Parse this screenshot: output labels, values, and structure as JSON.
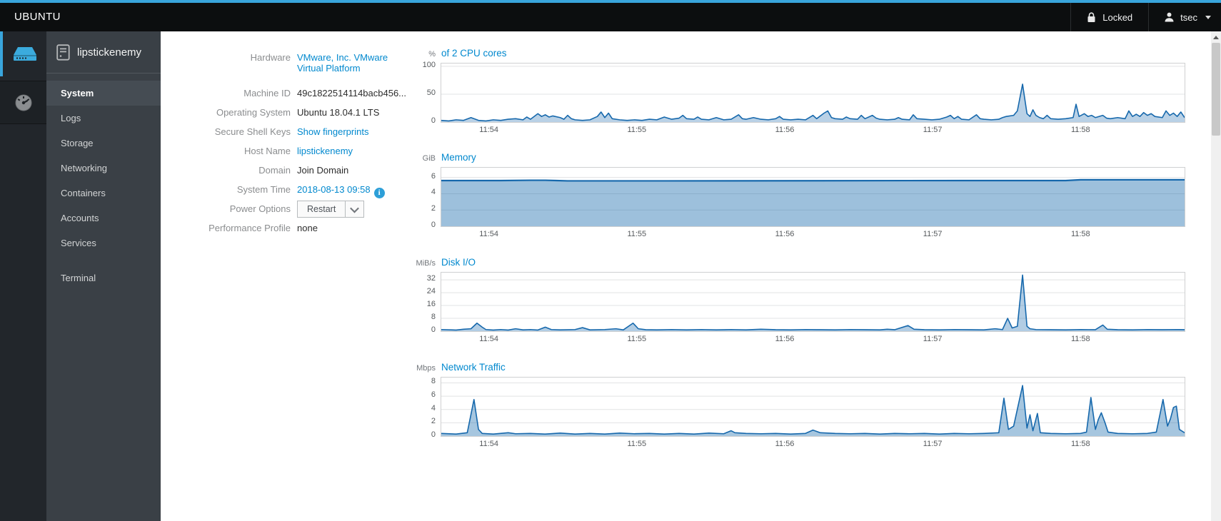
{
  "navbar": {
    "brand": "UBUNTU",
    "locked_label": "Locked",
    "user": "tsec"
  },
  "sidebar": {
    "host": "lipstickenemy",
    "items": [
      {
        "label": "System",
        "active": true
      },
      {
        "label": "Logs"
      },
      {
        "label": "Storage"
      },
      {
        "label": "Networking"
      },
      {
        "label": "Containers"
      },
      {
        "label": "Accounts"
      },
      {
        "label": "Services"
      }
    ],
    "terminal": {
      "label": "Terminal"
    }
  },
  "system": {
    "rows": [
      {
        "label": "Hardware",
        "value": "VMware, Inc. VMware Virtual Platform",
        "value_line1": "VMware, Inc. VMware",
        "value_line2": "Virtual Platform",
        "type": "link"
      },
      {
        "label": "Machine ID",
        "value": "49c1822514114bacb456...",
        "type": "text"
      },
      {
        "label": "Operating System",
        "value": "Ubuntu 18.04.1 LTS",
        "type": "text"
      },
      {
        "label": "Secure Shell Keys",
        "value": "Show fingerprints",
        "type": "link"
      },
      {
        "label": "Host Name",
        "value": "lipstickenemy",
        "type": "link"
      },
      {
        "label": "Domain",
        "value": "Join Domain",
        "type": "text"
      },
      {
        "label": "System Time",
        "value": "2018-08-13 09:58",
        "type": "link",
        "icon": "info-icon"
      },
      {
        "label": "Power Options",
        "value": "Restart",
        "type": "split-button"
      },
      {
        "label": "Performance Profile",
        "value": "none",
        "type": "text"
      }
    ]
  },
  "colors": {
    "accent": "#39a5dc",
    "link": "#0088ce",
    "chart_line": "#1668ac",
    "grid": "#e2e3e4"
  },
  "chart_data": [
    {
      "id": "cpu",
      "type": "area",
      "unit": "%",
      "title": "of 2 CPU cores",
      "ylabel": "percent",
      "ylim": [
        0,
        105
      ],
      "yticks": [
        100,
        50,
        0
      ],
      "grid": true,
      "xticks": [
        {
          "f": 0.065,
          "label": "11:54"
        },
        {
          "f": 0.264,
          "label": "11:55"
        },
        {
          "f": 0.463,
          "label": "11:56"
        },
        {
          "f": 0.662,
          "label": "11:57"
        },
        {
          "f": 0.861,
          "label": "11:58"
        }
      ],
      "line": "#1668ac",
      "fill": "rgba(22,104,172,0.30)",
      "line_width": 1.6,
      "points": [
        [
          0,
          3
        ],
        [
          0.01,
          2
        ],
        [
          0.02,
          4
        ],
        [
          0.03,
          3
        ],
        [
          0.04,
          8
        ],
        [
          0.05,
          3
        ],
        [
          0.06,
          2
        ],
        [
          0.07,
          4
        ],
        [
          0.08,
          3
        ],
        [
          0.09,
          5
        ],
        [
          0.1,
          6
        ],
        [
          0.11,
          4
        ],
        [
          0.115,
          9
        ],
        [
          0.12,
          5
        ],
        [
          0.13,
          15
        ],
        [
          0.135,
          10
        ],
        [
          0.14,
          13
        ],
        [
          0.145,
          9
        ],
        [
          0.15,
          11
        ],
        [
          0.16,
          8
        ],
        [
          0.165,
          5
        ],
        [
          0.17,
          12
        ],
        [
          0.175,
          6
        ],
        [
          0.18,
          4
        ],
        [
          0.19,
          3
        ],
        [
          0.2,
          4
        ],
        [
          0.21,
          10
        ],
        [
          0.215,
          18
        ],
        [
          0.22,
          8
        ],
        [
          0.225,
          16
        ],
        [
          0.23,
          6
        ],
        [
          0.24,
          4
        ],
        [
          0.25,
          3
        ],
        [
          0.26,
          4
        ],
        [
          0.27,
          3
        ],
        [
          0.28,
          5
        ],
        [
          0.29,
          4
        ],
        [
          0.3,
          9
        ],
        [
          0.31,
          5
        ],
        [
          0.32,
          7
        ],
        [
          0.325,
          12
        ],
        [
          0.33,
          6
        ],
        [
          0.34,
          5
        ],
        [
          0.345,
          9
        ],
        [
          0.35,
          5
        ],
        [
          0.36,
          4
        ],
        [
          0.37,
          8
        ],
        [
          0.38,
          4
        ],
        [
          0.39,
          5
        ],
        [
          0.4,
          13
        ],
        [
          0.405,
          6
        ],
        [
          0.41,
          5
        ],
        [
          0.42,
          8
        ],
        [
          0.43,
          5
        ],
        [
          0.44,
          4
        ],
        [
          0.45,
          6
        ],
        [
          0.455,
          10
        ],
        [
          0.46,
          5
        ],
        [
          0.47,
          4
        ],
        [
          0.48,
          5
        ],
        [
          0.49,
          4
        ],
        [
          0.5,
          12
        ],
        [
          0.505,
          6
        ],
        [
          0.515,
          16
        ],
        [
          0.52,
          20
        ],
        [
          0.525,
          8
        ],
        [
          0.53,
          6
        ],
        [
          0.54,
          5
        ],
        [
          0.545,
          9
        ],
        [
          0.55,
          6
        ],
        [
          0.56,
          5
        ],
        [
          0.565,
          12
        ],
        [
          0.57,
          6
        ],
        [
          0.58,
          12
        ],
        [
          0.585,
          7
        ],
        [
          0.59,
          5
        ],
        [
          0.6,
          4
        ],
        [
          0.61,
          5
        ],
        [
          0.615,
          8
        ],
        [
          0.62,
          5
        ],
        [
          0.63,
          4
        ],
        [
          0.635,
          13
        ],
        [
          0.64,
          6
        ],
        [
          0.65,
          5
        ],
        [
          0.66,
          4
        ],
        [
          0.67,
          5
        ],
        [
          0.68,
          9
        ],
        [
          0.685,
          12
        ],
        [
          0.69,
          6
        ],
        [
          0.695,
          10
        ],
        [
          0.7,
          5
        ],
        [
          0.71,
          4
        ],
        [
          0.72,
          13
        ],
        [
          0.725,
          6
        ],
        [
          0.73,
          5
        ],
        [
          0.74,
          4
        ],
        [
          0.75,
          5
        ],
        [
          0.755,
          8
        ],
        [
          0.76,
          10
        ],
        [
          0.77,
          12
        ],
        [
          0.775,
          20
        ],
        [
          0.782,
          68
        ],
        [
          0.788,
          15
        ],
        [
          0.792,
          10
        ],
        [
          0.796,
          22
        ],
        [
          0.8,
          12
        ],
        [
          0.805,
          8
        ],
        [
          0.81,
          6
        ],
        [
          0.815,
          12
        ],
        [
          0.82,
          6
        ],
        [
          0.83,
          5
        ],
        [
          0.84,
          6
        ],
        [
          0.85,
          8
        ],
        [
          0.854,
          32
        ],
        [
          0.858,
          10
        ],
        [
          0.865,
          15
        ],
        [
          0.87,
          10
        ],
        [
          0.875,
          12
        ],
        [
          0.88,
          8
        ],
        [
          0.89,
          12
        ],
        [
          0.895,
          7
        ],
        [
          0.9,
          6
        ],
        [
          0.91,
          8
        ],
        [
          0.92,
          6
        ],
        [
          0.925,
          20
        ],
        [
          0.93,
          10
        ],
        [
          0.935,
          14
        ],
        [
          0.94,
          10
        ],
        [
          0.945,
          17
        ],
        [
          0.95,
          12
        ],
        [
          0.955,
          15
        ],
        [
          0.96,
          10
        ],
        [
          0.97,
          8
        ],
        [
          0.975,
          20
        ],
        [
          0.98,
          12
        ],
        [
          0.985,
          16
        ],
        [
          0.99,
          10
        ],
        [
          0.995,
          18
        ],
        [
          1,
          8
        ]
      ]
    },
    {
      "id": "memory",
      "type": "area",
      "unit": "GiB",
      "title": "Memory",
      "ylabel": "GiB",
      "ylim": [
        0,
        7.2
      ],
      "yticks": [
        6,
        4,
        2,
        0
      ],
      "grid": true,
      "xticks": [
        {
          "f": 0.065,
          "label": "11:54"
        },
        {
          "f": 0.264,
          "label": "11:55"
        },
        {
          "f": 0.463,
          "label": "11:56"
        },
        {
          "f": 0.662,
          "label": "11:57"
        },
        {
          "f": 0.861,
          "label": "11:58"
        }
      ],
      "line": "#1668ac",
      "fill": "rgba(22,104,172,0.42)",
      "line_width": 2.2,
      "points": [
        [
          0,
          5.62
        ],
        [
          0.08,
          5.62
        ],
        [
          0.12,
          5.66
        ],
        [
          0.14,
          5.66
        ],
        [
          0.155,
          5.62
        ],
        [
          0.17,
          5.58
        ],
        [
          0.3,
          5.58
        ],
        [
          0.5,
          5.6
        ],
        [
          0.7,
          5.62
        ],
        [
          0.84,
          5.62
        ],
        [
          0.86,
          5.72
        ],
        [
          1,
          5.72
        ]
      ]
    },
    {
      "id": "disk-io",
      "type": "area",
      "unit": "MiB/s",
      "title": "Disk I/O",
      "ylabel": "MiB/s",
      "ylim": [
        0,
        36.5
      ],
      "yticks": [
        32,
        24,
        16,
        8,
        0
      ],
      "grid": true,
      "xticks": [
        {
          "f": 0.065,
          "label": "11:54"
        },
        {
          "f": 0.264,
          "label": "11:55"
        },
        {
          "f": 0.463,
          "label": "11:56"
        },
        {
          "f": 0.662,
          "label": "11:57"
        },
        {
          "f": 0.861,
          "label": "11:58"
        }
      ],
      "line": "#1668ac",
      "fill": "rgba(22,104,172,0.33)",
      "line_width": 1.6,
      "points": [
        [
          0,
          1
        ],
        [
          0.02,
          0.7
        ],
        [
          0.03,
          1.2
        ],
        [
          0.04,
          1.5
        ],
        [
          0.048,
          5
        ],
        [
          0.055,
          2.5
        ],
        [
          0.06,
          1
        ],
        [
          0.07,
          0.7
        ],
        [
          0.08,
          1
        ],
        [
          0.09,
          0.7
        ],
        [
          0.1,
          1.5
        ],
        [
          0.11,
          0.8
        ],
        [
          0.12,
          1
        ],
        [
          0.13,
          0.7
        ],
        [
          0.14,
          2.5
        ],
        [
          0.148,
          1
        ],
        [
          0.16,
          0.8
        ],
        [
          0.18,
          1
        ],
        [
          0.19,
          2.2
        ],
        [
          0.2,
          0.8
        ],
        [
          0.22,
          1
        ],
        [
          0.235,
          1.5
        ],
        [
          0.245,
          0.8
        ],
        [
          0.258,
          5
        ],
        [
          0.265,
          1.5
        ],
        [
          0.275,
          0.9
        ],
        [
          0.29,
          0.8
        ],
        [
          0.31,
          1
        ],
        [
          0.33,
          0.8
        ],
        [
          0.35,
          1
        ],
        [
          0.37,
          0.8
        ],
        [
          0.39,
          1
        ],
        [
          0.41,
          0.8
        ],
        [
          0.43,
          1.2
        ],
        [
          0.45,
          0.9
        ],
        [
          0.47,
          0.8
        ],
        [
          0.49,
          1
        ],
        [
          0.51,
          0.9
        ],
        [
          0.53,
          0.8
        ],
        [
          0.55,
          1
        ],
        [
          0.57,
          0.9
        ],
        [
          0.59,
          0.8
        ],
        [
          0.6,
          1.2
        ],
        [
          0.61,
          0.9
        ],
        [
          0.628,
          3.5
        ],
        [
          0.636,
          1.2
        ],
        [
          0.65,
          0.9
        ],
        [
          0.67,
          0.8
        ],
        [
          0.69,
          1
        ],
        [
          0.71,
          0.9
        ],
        [
          0.73,
          0.8
        ],
        [
          0.745,
          1.5
        ],
        [
          0.755,
          1
        ],
        [
          0.762,
          8
        ],
        [
          0.768,
          2
        ],
        [
          0.775,
          3
        ],
        [
          0.782,
          35
        ],
        [
          0.788,
          3
        ],
        [
          0.792,
          1.5
        ],
        [
          0.8,
          1
        ],
        [
          0.82,
          0.9
        ],
        [
          0.84,
          0.8
        ],
        [
          0.86,
          1
        ],
        [
          0.88,
          0.9
        ],
        [
          0.89,
          3.8
        ],
        [
          0.896,
          1.2
        ],
        [
          0.91,
          0.9
        ],
        [
          0.93,
          0.8
        ],
        [
          0.95,
          1
        ],
        [
          0.97,
          0.9
        ],
        [
          0.99,
          1
        ],
        [
          1,
          0.9
        ]
      ]
    },
    {
      "id": "network",
      "type": "area",
      "unit": "Mbps",
      "title": "Network Traffic",
      "ylabel": "Mbps",
      "ylim": [
        0,
        8.8
      ],
      "yticks": [
        8,
        6,
        4,
        2,
        0
      ],
      "grid": true,
      "xticks": [
        {
          "f": 0.065,
          "label": "11:54"
        },
        {
          "f": 0.264,
          "label": "11:55"
        },
        {
          "f": 0.463,
          "label": "11:56"
        },
        {
          "f": 0.662,
          "label": "11:57"
        },
        {
          "f": 0.861,
          "label": "11:58"
        }
      ],
      "line": "#1668ac",
      "fill": "rgba(22,104,172,0.38)",
      "line_width": 1.6,
      "points": [
        [
          0,
          0.4
        ],
        [
          0.02,
          0.3
        ],
        [
          0.035,
          0.5
        ],
        [
          0.044,
          5.5
        ],
        [
          0.05,
          1
        ],
        [
          0.055,
          0.4
        ],
        [
          0.07,
          0.3
        ],
        [
          0.09,
          0.5
        ],
        [
          0.1,
          0.35
        ],
        [
          0.12,
          0.4
        ],
        [
          0.14,
          0.3
        ],
        [
          0.16,
          0.45
        ],
        [
          0.18,
          0.3
        ],
        [
          0.2,
          0.4
        ],
        [
          0.22,
          0.3
        ],
        [
          0.24,
          0.45
        ],
        [
          0.26,
          0.35
        ],
        [
          0.28,
          0.4
        ],
        [
          0.3,
          0.3
        ],
        [
          0.32,
          0.4
        ],
        [
          0.34,
          0.3
        ],
        [
          0.36,
          0.45
        ],
        [
          0.38,
          0.35
        ],
        [
          0.39,
          0.8
        ],
        [
          0.395,
          0.5
        ],
        [
          0.41,
          0.4
        ],
        [
          0.43,
          0.35
        ],
        [
          0.45,
          0.4
        ],
        [
          0.47,
          0.3
        ],
        [
          0.49,
          0.4
        ],
        [
          0.5,
          0.9
        ],
        [
          0.51,
          0.5
        ],
        [
          0.53,
          0.4
        ],
        [
          0.55,
          0.35
        ],
        [
          0.57,
          0.4
        ],
        [
          0.59,
          0.3
        ],
        [
          0.61,
          0.4
        ],
        [
          0.63,
          0.35
        ],
        [
          0.65,
          0.4
        ],
        [
          0.67,
          0.3
        ],
        [
          0.69,
          0.4
        ],
        [
          0.71,
          0.35
        ],
        [
          0.73,
          0.4
        ],
        [
          0.75,
          0.5
        ],
        [
          0.757,
          5.7
        ],
        [
          0.763,
          1
        ],
        [
          0.77,
          1.5
        ],
        [
          0.782,
          7.6
        ],
        [
          0.788,
          1.2
        ],
        [
          0.792,
          3.2
        ],
        [
          0.796,
          0.8
        ],
        [
          0.802,
          3.4
        ],
        [
          0.806,
          0.5
        ],
        [
          0.82,
          0.4
        ],
        [
          0.84,
          0.35
        ],
        [
          0.86,
          0.4
        ],
        [
          0.868,
          0.6
        ],
        [
          0.874,
          5.8
        ],
        [
          0.88,
          1
        ],
        [
          0.884,
          2.5
        ],
        [
          0.888,
          3.5
        ],
        [
          0.893,
          2
        ],
        [
          0.897,
          0.6
        ],
        [
          0.91,
          0.4
        ],
        [
          0.93,
          0.35
        ],
        [
          0.95,
          0.4
        ],
        [
          0.962,
          0.6
        ],
        [
          0.971,
          5.5
        ],
        [
          0.977,
          1.5
        ],
        [
          0.981,
          2.6
        ],
        [
          0.985,
          4.3
        ],
        [
          0.989,
          4.5
        ],
        [
          0.993,
          1
        ],
        [
          1,
          0.5
        ]
      ]
    }
  ]
}
